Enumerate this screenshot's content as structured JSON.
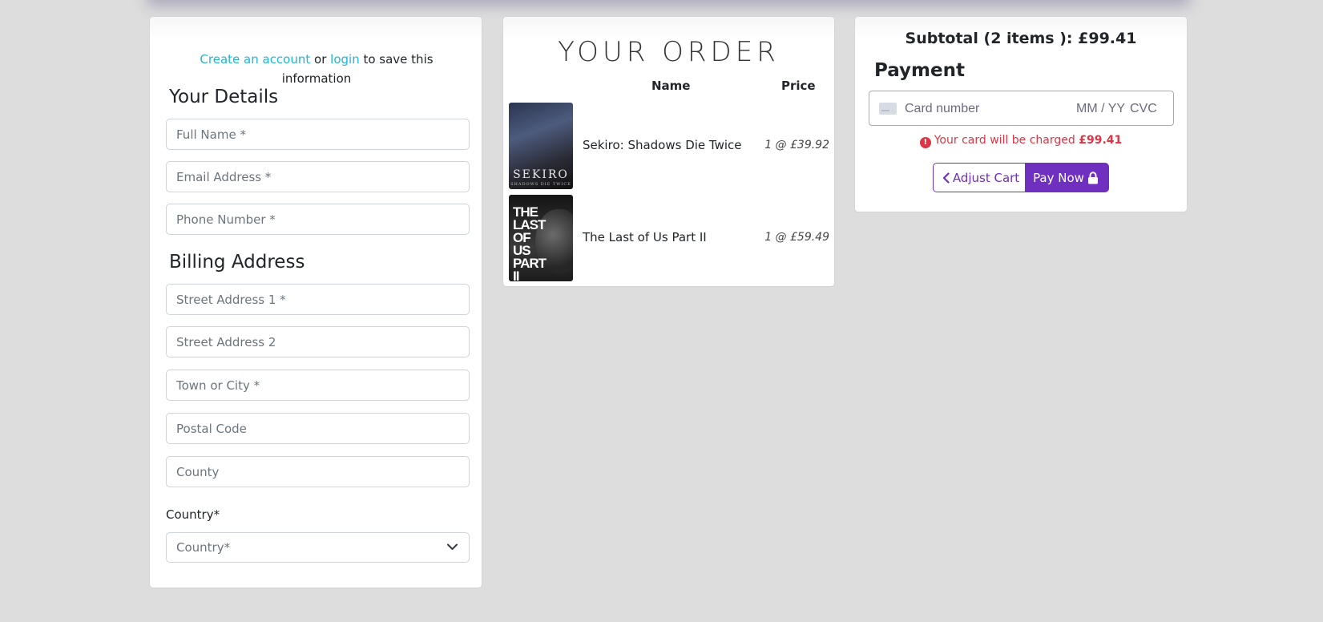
{
  "details": {
    "create_account_link": "Create an account",
    "or_text": " or ",
    "login_link": "login",
    "save_info_text": " to save this information",
    "your_details_title": "Your Details",
    "full_name_placeholder": "Full Name *",
    "email_placeholder": "Email Address *",
    "phone_placeholder": "Phone Number *",
    "billing_title": "Billing Address",
    "street1_placeholder": "Street Address 1 *",
    "street2_placeholder": "Street Address 2",
    "town_placeholder": "Town or City *",
    "postal_placeholder": "Postal Code",
    "county_placeholder": "County",
    "country_label": "Country*",
    "country_selected": "Country*"
  },
  "order": {
    "title": "YOUR ORDER",
    "col_name": "Name",
    "col_price": "Price",
    "items": [
      {
        "name": "Sekiro: Shadows Die Twice",
        "price": "1 @ £39.92",
        "cover_text": "SEKIRO",
        "cover_sub": "SHADOWS DIE TWICE"
      },
      {
        "name": "The Last of Us Part II",
        "price": "1 @ £59.49",
        "cover_text": "THE LAST OF US PART II"
      }
    ]
  },
  "payment": {
    "subtotal": "Subtotal (2 items ): £99.41",
    "title": "Payment",
    "card_number_placeholder": "Card number",
    "expiry_placeholder": "MM / YY",
    "cvc_placeholder": "CVC",
    "charge_note_prefix": "Your card will be charged ",
    "charge_amount": "£99.41",
    "adjust_cart_label": "Adjust Cart",
    "pay_now_label": "Pay Now"
  },
  "colors": {
    "accent": "#6f2fbf",
    "link": "#1fb7d6",
    "danger": "#dc3545",
    "background": "#dddddd"
  }
}
